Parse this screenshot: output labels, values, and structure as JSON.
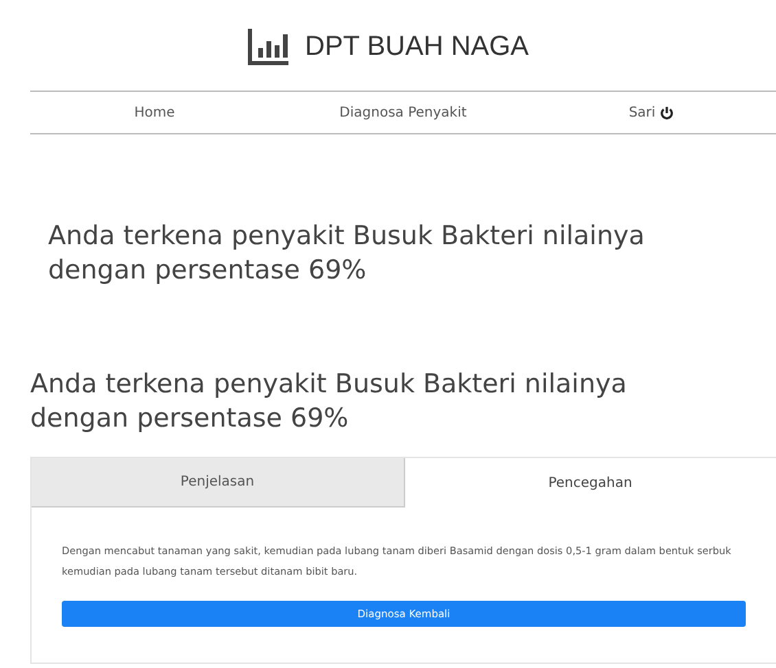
{
  "header": {
    "title": "DPT BUAH NAGA"
  },
  "nav": {
    "items": [
      {
        "label": "Home",
        "kind": "link"
      },
      {
        "label": "Diagnosa Penyakit",
        "kind": "link"
      },
      {
        "label": "Sari",
        "kind": "logout"
      }
    ]
  },
  "results": [
    {
      "text": "Anda terkena penyakit Busuk Bakteri nilainya dengan persentase 69%"
    },
    {
      "text": "Anda terkena penyakit Busuk Bakteri nilainya dengan persentase 69%"
    }
  ],
  "tabs": [
    {
      "label": "Penjelasan",
      "selected": false
    },
    {
      "label": "Pencegahan",
      "selected": true
    }
  ],
  "panel": {
    "text": "Dengan mencabut tanaman yang sakit, kemudian pada lubang tanam diberi Basamid dengan dosis 0,5-1 gram dalam bentuk serbuk kemudian pada lubang tanam tersebut ditanam bibit baru.",
    "button": "Diagnosa Kembali"
  }
}
